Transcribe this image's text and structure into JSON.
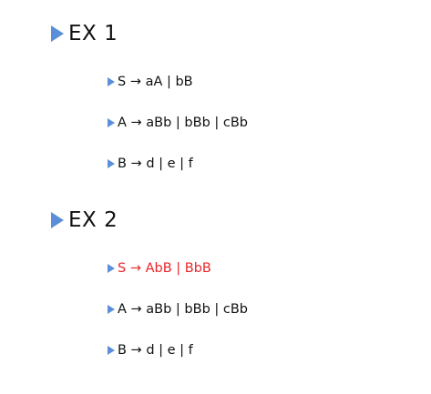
{
  "sections": [
    {
      "heading": "EX 1",
      "rules": [
        {
          "text": "S → aA | bB",
          "highlight": false
        },
        {
          "text": "A → aBb | bBb | cBb",
          "highlight": false
        },
        {
          "text": "B → d | e | f",
          "highlight": false
        }
      ]
    },
    {
      "heading": "EX 2",
      "rules": [
        {
          "text": "S → AbB | BbB",
          "highlight": true
        },
        {
          "text": "A → aBb | bBb | cBb",
          "highlight": false
        },
        {
          "text": "B → d | e | f",
          "highlight": false
        }
      ]
    }
  ],
  "colors": {
    "bullet": "#5b8fd9",
    "highlight_text": "#e8262b",
    "text": "#111111"
  }
}
